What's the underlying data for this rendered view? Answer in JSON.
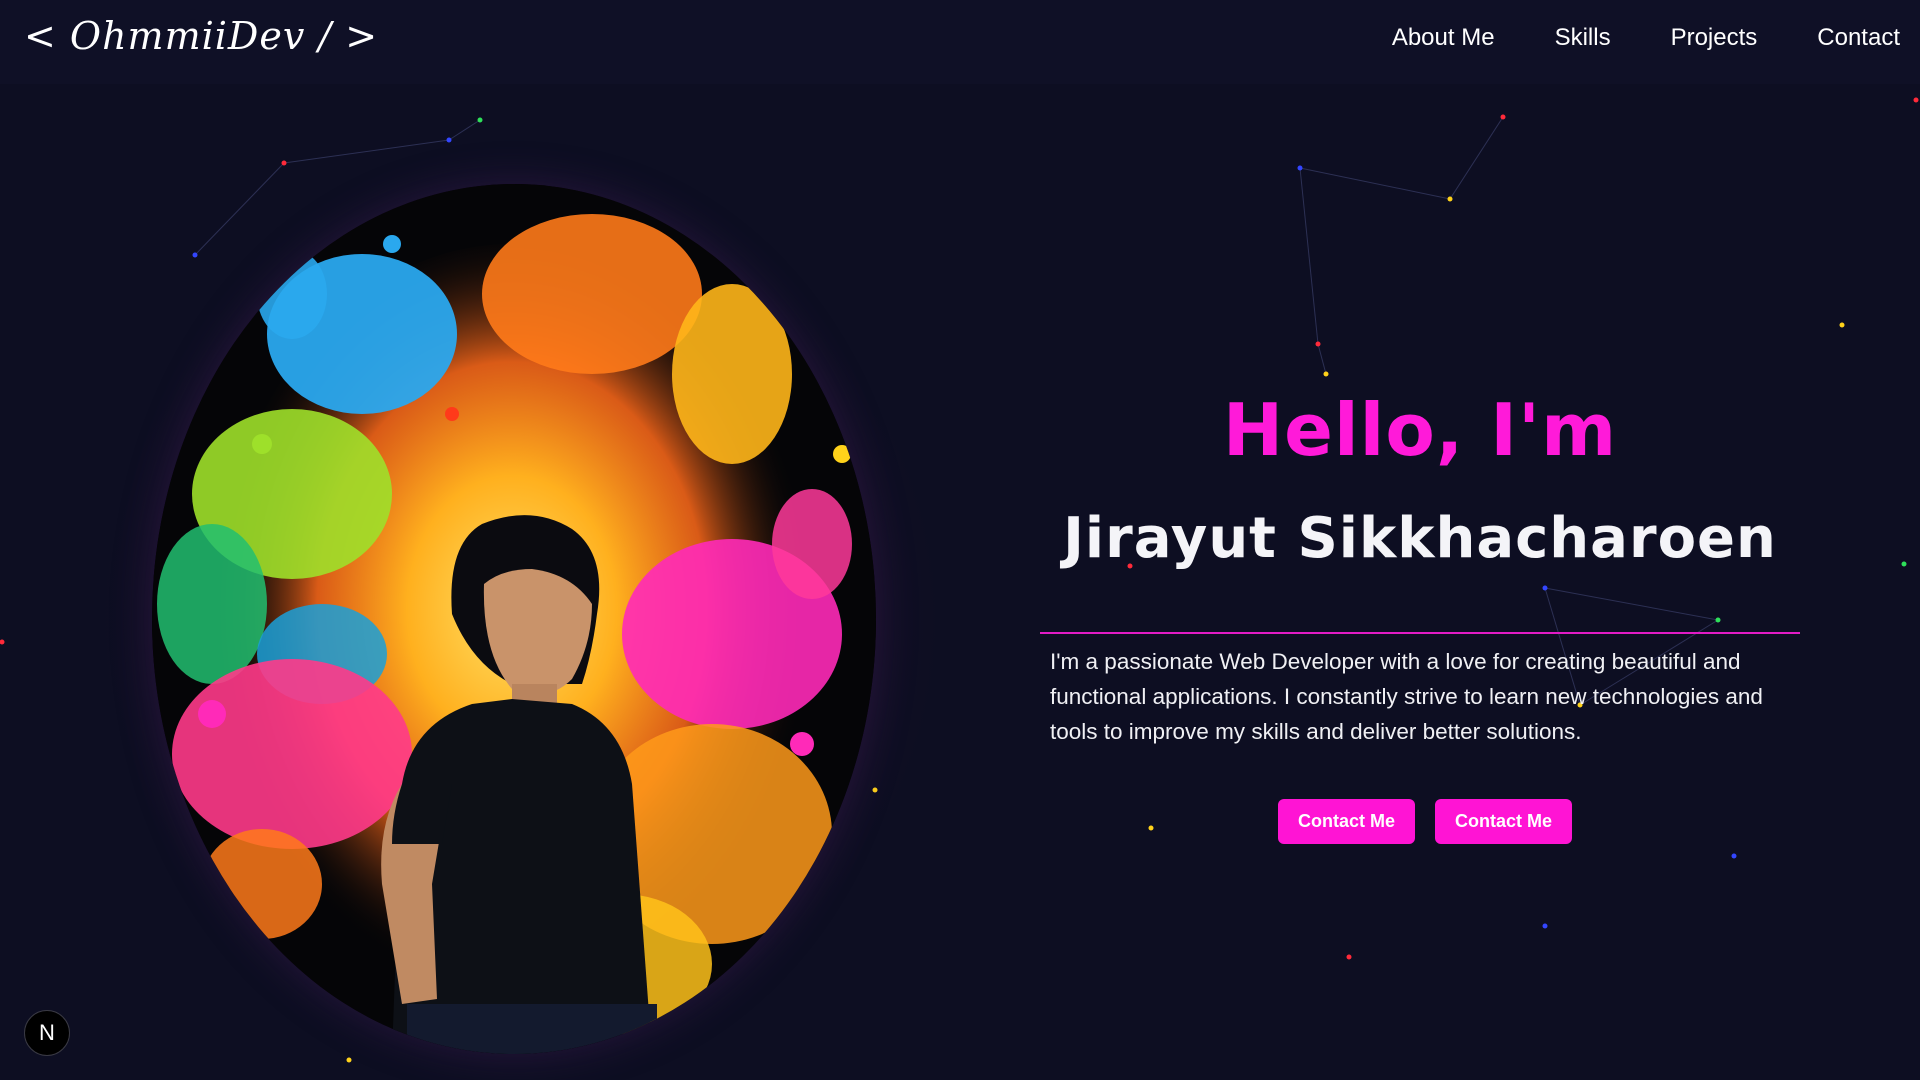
{
  "nav": {
    "logo": "< OhmmiiDev / >",
    "links": [
      "About Me",
      "Skills",
      "Projects",
      "Contact"
    ]
  },
  "hero": {
    "greeting": "Hello, I'm",
    "name": "Jirayut Sikkhacharoen",
    "bio": "I'm a passionate Web Developer with a love for creating beautiful and functional applications. I constantly strive to learn new technologies and tools to improve my skills and deliver better solutions.",
    "buttons": [
      "Contact Me",
      "Contact Me"
    ]
  },
  "badge": {
    "label": "N"
  },
  "colors": {
    "background": "#0d0e22",
    "navbar": "#0f1026",
    "accent": "#ff14d4",
    "divider": "#e21bc6",
    "text": "#ffffff"
  },
  "icons": {
    "badge": "next-js-n-icon"
  }
}
